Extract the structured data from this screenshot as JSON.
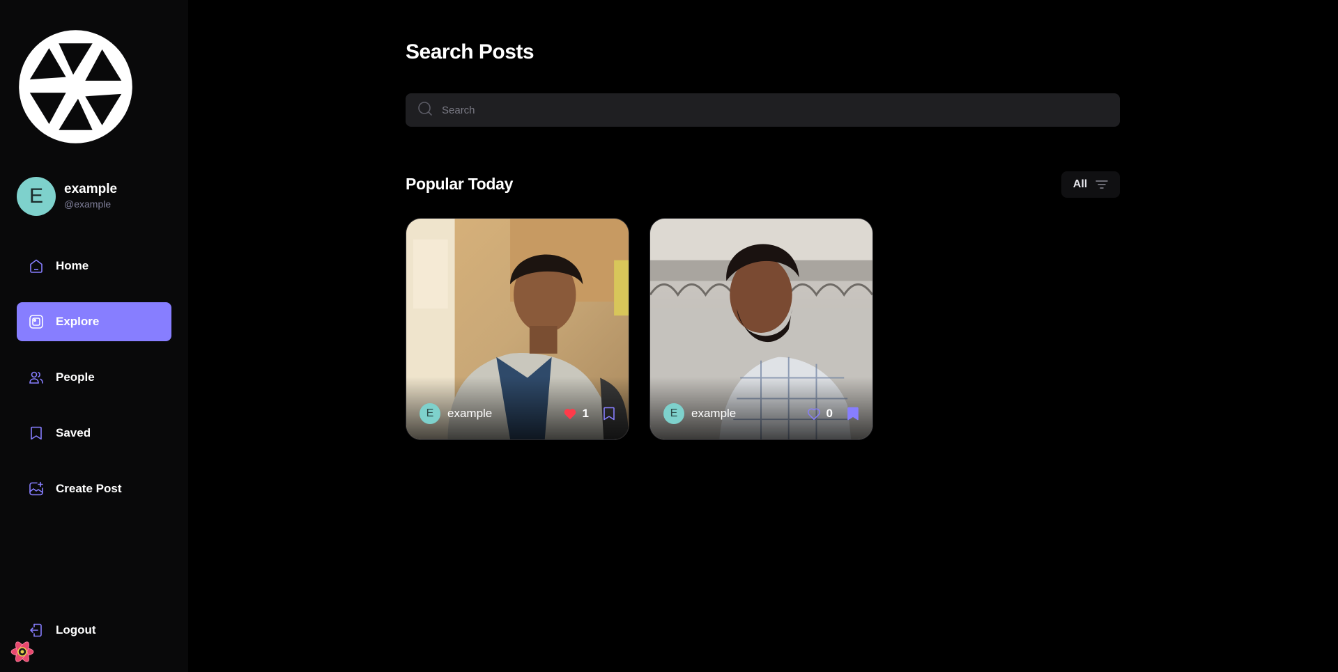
{
  "sidebar": {
    "user": {
      "initial": "E",
      "name": "example",
      "handle": "@example"
    },
    "nav": [
      {
        "label": "Home",
        "icon": "home-icon"
      },
      {
        "label": "Explore",
        "icon": "explore-icon",
        "active": true
      },
      {
        "label": "People",
        "icon": "people-icon"
      },
      {
        "label": "Saved",
        "icon": "bookmark-icon"
      },
      {
        "label": "Create Post",
        "icon": "create-post-icon"
      }
    ],
    "logout_label": "Logout"
  },
  "main": {
    "title": "Search Posts",
    "search": {
      "placeholder": "Search",
      "value": ""
    },
    "section_title": "Popular Today",
    "filter_label": "All",
    "posts": [
      {
        "author_initial": "E",
        "author": "example",
        "likes": "1",
        "liked": true,
        "saved": false
      },
      {
        "author_initial": "E",
        "author": "example",
        "likes": "0",
        "liked": false,
        "saved": true
      }
    ]
  },
  "colors": {
    "accent": "#877eff",
    "background": "#000000",
    "sidebar": "#09090a",
    "avatar": "#7ed1cc",
    "like": "#ff3b4a"
  }
}
